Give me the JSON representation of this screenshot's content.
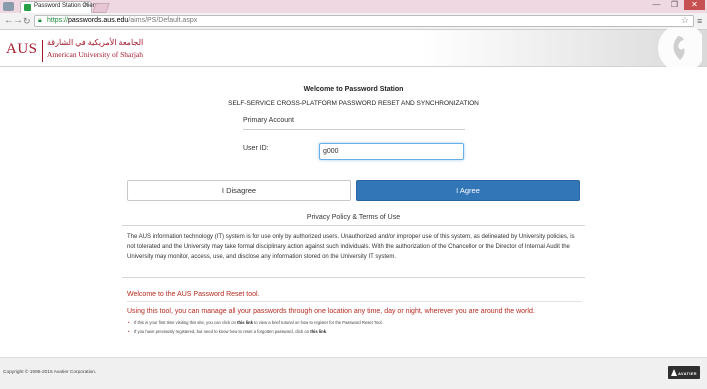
{
  "browser": {
    "tab_title": "Password Station Client",
    "tab_close": "×",
    "url_protocol": "https://",
    "url_host": "passwords.aus.edu",
    "url_path": "/aims/PS/Default.aspx",
    "min_glyph": "—",
    "max_glyph": "❐",
    "close_glyph": "✕",
    "star_glyph": "☆",
    "menu_glyph": "≡"
  },
  "header": {
    "logo_text": "AUS",
    "logo_arabic": "الجامعة الأمريكية في الشارقة",
    "logo_english": "American University of Sharjah"
  },
  "main": {
    "welcome_title": "Welcome to Password Station",
    "welcome_subtitle": "SELF-SERVICE CROSS-PLATFORM PASSWORD RESET AND SYNCHRONIZATION",
    "primary_account": "Primary Account",
    "userid_label": "User ID:",
    "userid_value": "g000",
    "disagree_label": "I Disagree",
    "agree_label": "I Agree",
    "policy_title": "Privacy Policy & Terms of Use",
    "policy_text": "The AUS information technology (IT) system is for use only by authorized users. Unauthorized and/or improper use of this system, as delineated by University policies, is not tolerated and the University may take formal disciplinary action against such individuals. With the authorization of the Chancellor or the Director of Internal Audit the University may monitor, access, use, and disclose any information stored on the University IT system.",
    "reset_title": "Welcome to the AUS Password Reset tool.",
    "reset_desc": "Using this tool, you can manage all your passwords through one location any time, day or night, wherever you are around the world.",
    "tip1_before": "If this is your first time visiting this site, you can click on ",
    "tip1_link": "this link",
    "tip1_after": " to view a brief tutorial on how to register for the Password Reset Tool.",
    "tip2_before": "If you have previously registered, but need to know how to reset a forgotten password, click on ",
    "tip2_link": "this link",
    "tip2_after": "."
  },
  "footer": {
    "copyright": "Copyright © 1995-2015 Avatier Corporation.",
    "logo_text": "AVATIER"
  },
  "colors": {
    "brand_red": "#a3192c",
    "primary_blue": "#3276b8",
    "notice_red": "#b72a1f"
  }
}
